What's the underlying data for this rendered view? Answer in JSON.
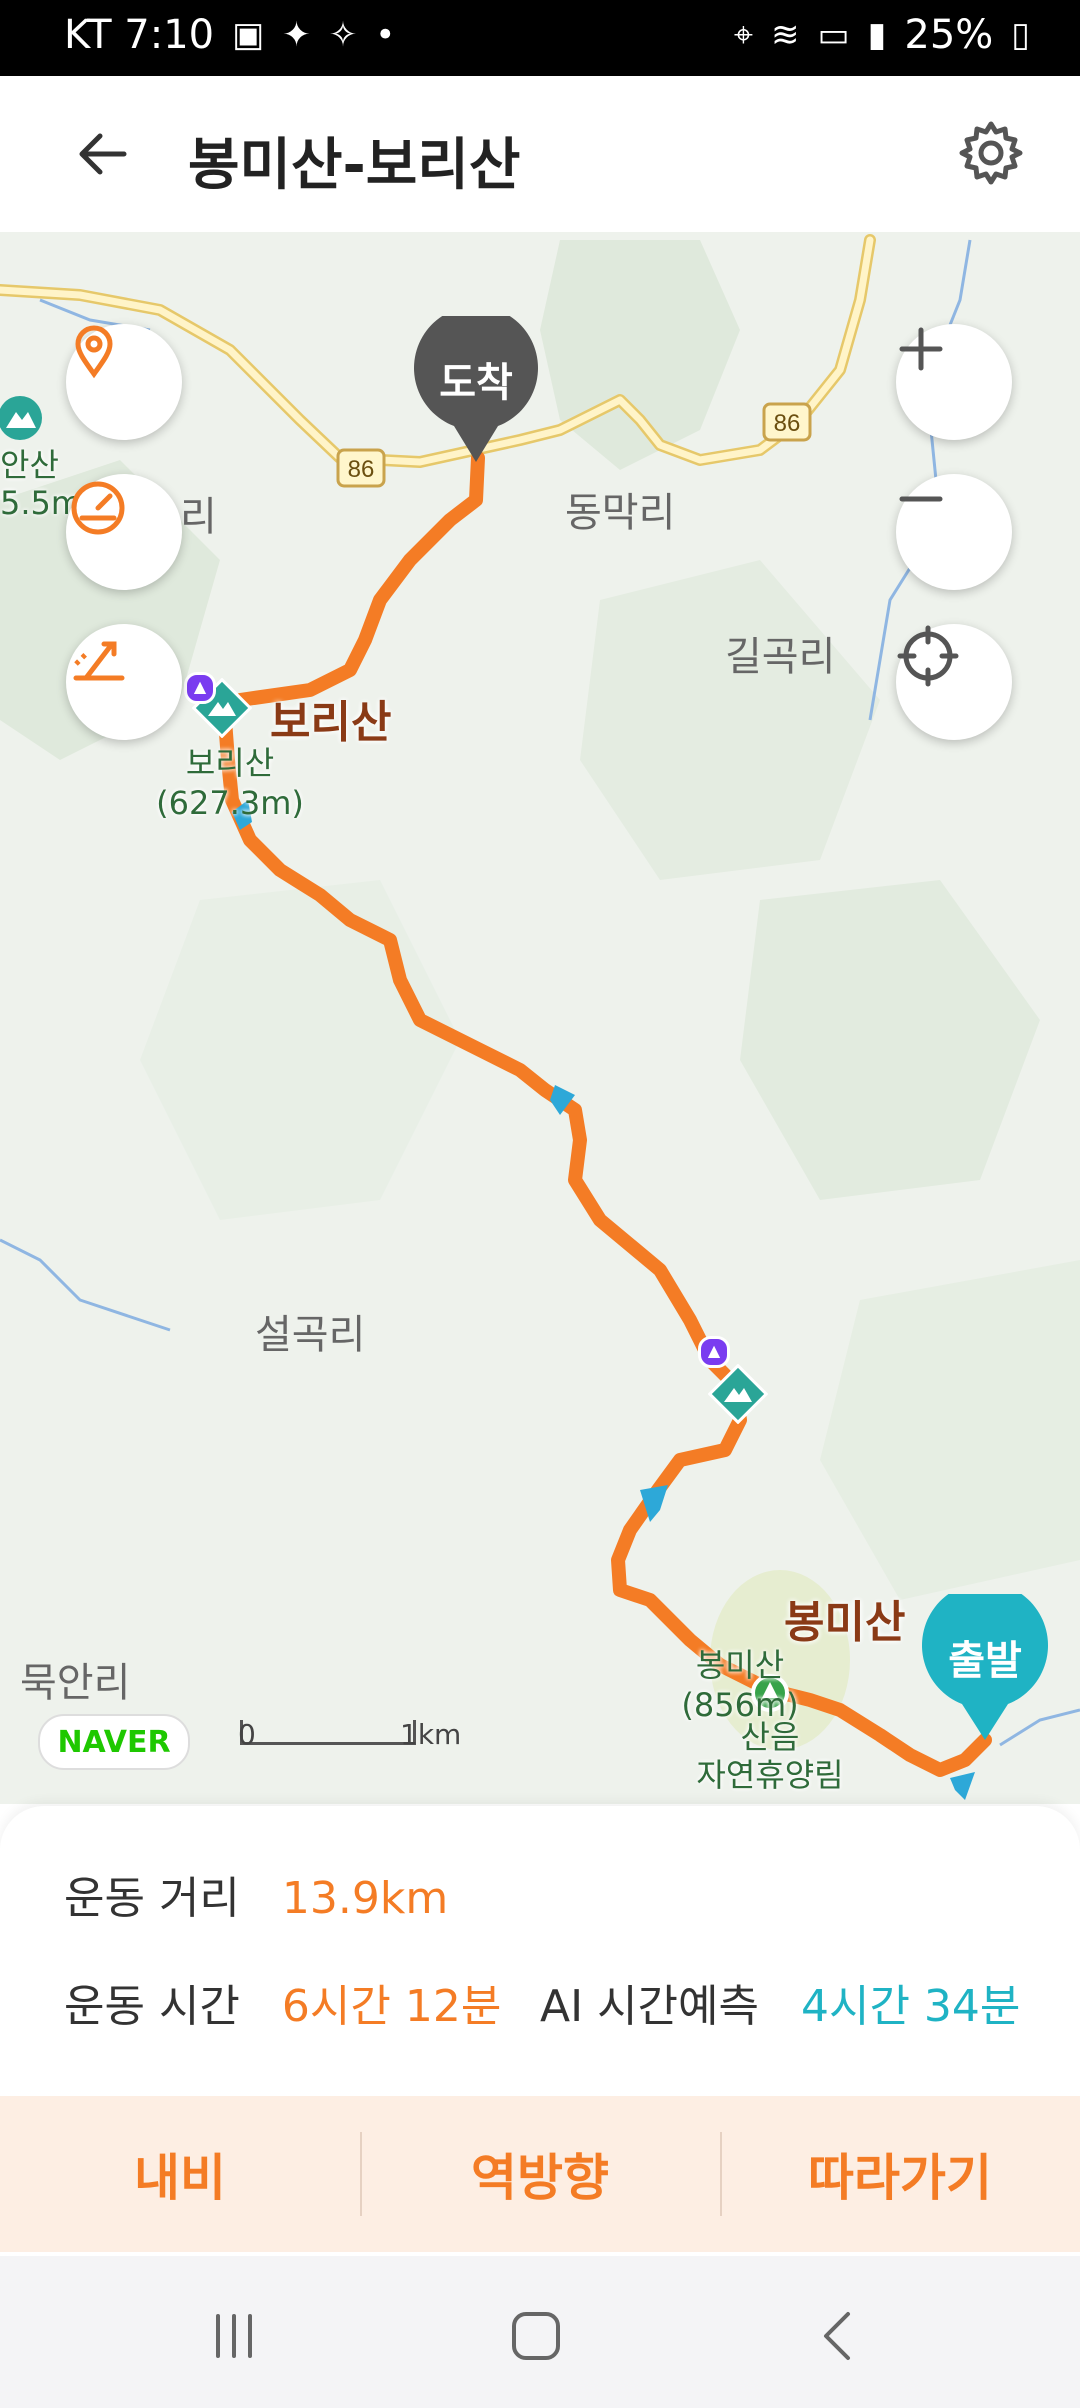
{
  "status_bar": {
    "carrier_time": "KT 7:10",
    "battery": "25%"
  },
  "header": {
    "title": "봉미산-보리산",
    "back_icon": "arrow-left-icon",
    "settings_icon": "gear-icon"
  },
  "map": {
    "places": {
      "dongmakri": "동막리",
      "gilgokri": "길곡리",
      "seolgokri": "설곡리",
      "mukanri": "묵안리",
      "ri_partial": "리",
      "san_partial": "안산",
      "elev_partial": "5.5m)"
    },
    "road_number": "86",
    "arrive_label": "도착",
    "start_label": "출발",
    "peaks": [
      {
        "name": "보리산",
        "sub_name": "보리산",
        "sub_elev": "(627.3m)"
      },
      {
        "name": "봉미산",
        "sub_name": "봉미산",
        "sub_elev": "(856m)"
      }
    ],
    "poi": {
      "line1": "산음",
      "line2": "자연휴양림"
    },
    "naver": "NAVER",
    "scale": {
      "zero": "0",
      "km": "1km"
    }
  },
  "info": {
    "distance_label": "운동 거리",
    "distance_value": "13.9km",
    "time_label": "운동 시간",
    "time_value": "6시간 12분",
    "ai_label": "AI 시간예측",
    "ai_value": "4시간 34분"
  },
  "actions": {
    "navi": "내비",
    "reverse": "역방향",
    "follow": "따라가기"
  },
  "colors": {
    "route": "#f47c25",
    "accent_cyan": "#1fb3c4",
    "arrive_pin": "#555555",
    "peak_marker": "#2aa597"
  }
}
